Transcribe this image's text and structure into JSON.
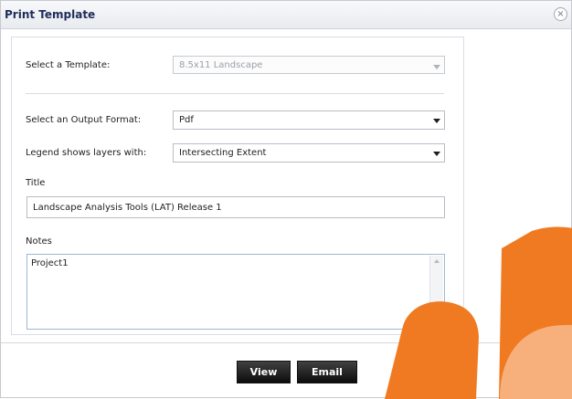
{
  "dialog": {
    "title": "Print Template",
    "close_symbol": "×"
  },
  "form": {
    "template_label": "Select a Template:",
    "template_value": "8.5x11 Landscape",
    "output_format_label": "Select an Output Format:",
    "output_format_value": "Pdf",
    "legend_label": "Legend shows layers with:",
    "legend_value": "Intersecting Extent",
    "title_label": "Title",
    "title_value": "Landscape Analysis Tools (LAT) Release 1",
    "notes_label": "Notes",
    "notes_value": "Project1"
  },
  "buttons": {
    "view": "View",
    "email": "Email"
  },
  "icons": {
    "close": "close-icon",
    "dropdown": "chevron-down-icon",
    "scroll_up": "chevron-up-icon",
    "scroll_down": "chevron-down-icon"
  },
  "colors": {
    "title_text": "#1e2c5a",
    "button_bg": "#0c0c0c",
    "button_text": "#ffffff",
    "decor_orange": "#f07a21",
    "decor_orange_light": "#f7b07b"
  }
}
